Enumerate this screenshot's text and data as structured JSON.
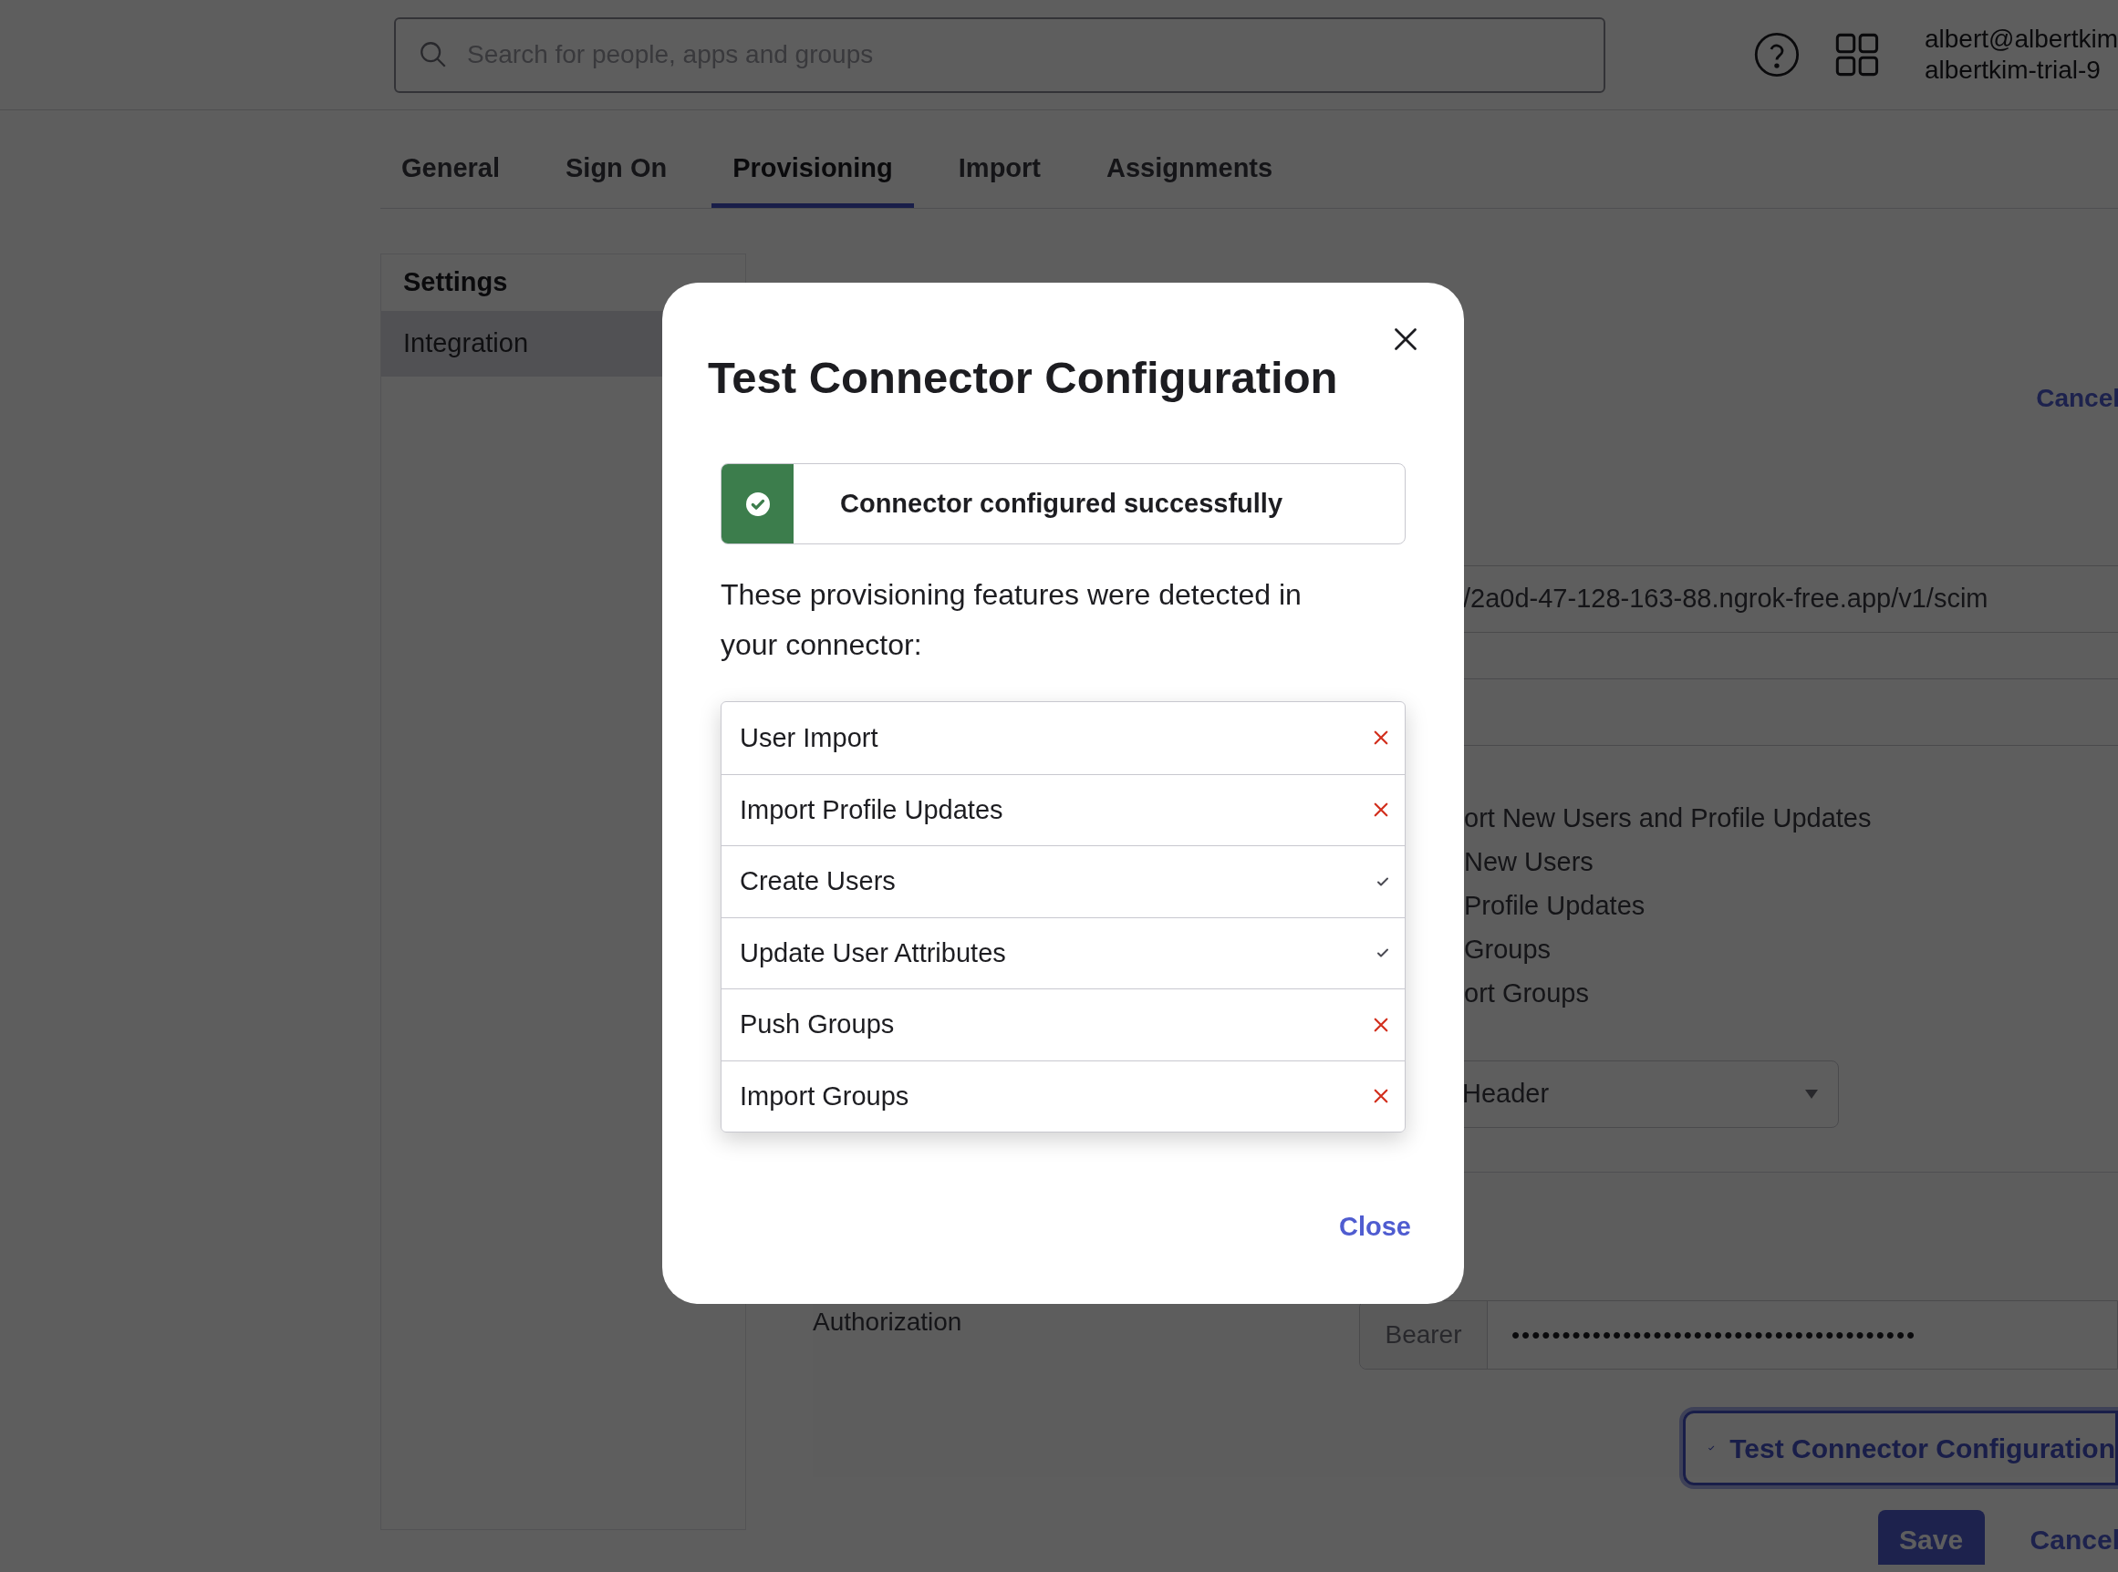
{
  "header": {
    "search": {
      "placeholder": "Search for people, apps and groups"
    },
    "user": {
      "email": "albert@albertkim",
      "org": "albertkim-trial-9"
    }
  },
  "tabs": [
    {
      "label": "General",
      "selected": false
    },
    {
      "label": "Sign On",
      "selected": false
    },
    {
      "label": "Provisioning",
      "selected": true
    },
    {
      "label": "Import",
      "selected": false
    },
    {
      "label": "Assignments",
      "selected": false
    }
  ],
  "sidebar": {
    "title": "Settings",
    "items": [
      {
        "label": "Integration",
        "selected": true
      }
    ]
  },
  "content": {
    "cancel_top": "Cancel",
    "base_url": "/2a0d-47-128-163-88.ngrok-free.app/v1/scim",
    "options": [
      {
        "label": "ort New Users and Profile Updates"
      },
      {
        "label": "New Users"
      },
      {
        "label": "Profile Updates"
      },
      {
        "label": "Groups"
      },
      {
        "label": "ort Groups"
      }
    ],
    "auth_mode": "Header",
    "authorization_label": "Authorization",
    "bearer_prefix": "Bearer",
    "token_mask": "••••••••••••••••••••••••••••••••••••••••",
    "test_button": "Test Connector Configuration",
    "save": "Save",
    "cancel": "Cancel"
  },
  "modal": {
    "title": "Test Connector Configuration",
    "status": "Connector configured successfully",
    "intro": "These provisioning features were detected in your connector:",
    "features": [
      {
        "label": "User Import",
        "detected": false
      },
      {
        "label": "Import Profile Updates",
        "detected": false
      },
      {
        "label": "Create Users",
        "detected": true
      },
      {
        "label": "Update User Attributes",
        "detected": true
      },
      {
        "label": "Push Groups",
        "detected": false
      },
      {
        "label": "Import Groups",
        "detected": false
      }
    ],
    "close": "Close"
  }
}
